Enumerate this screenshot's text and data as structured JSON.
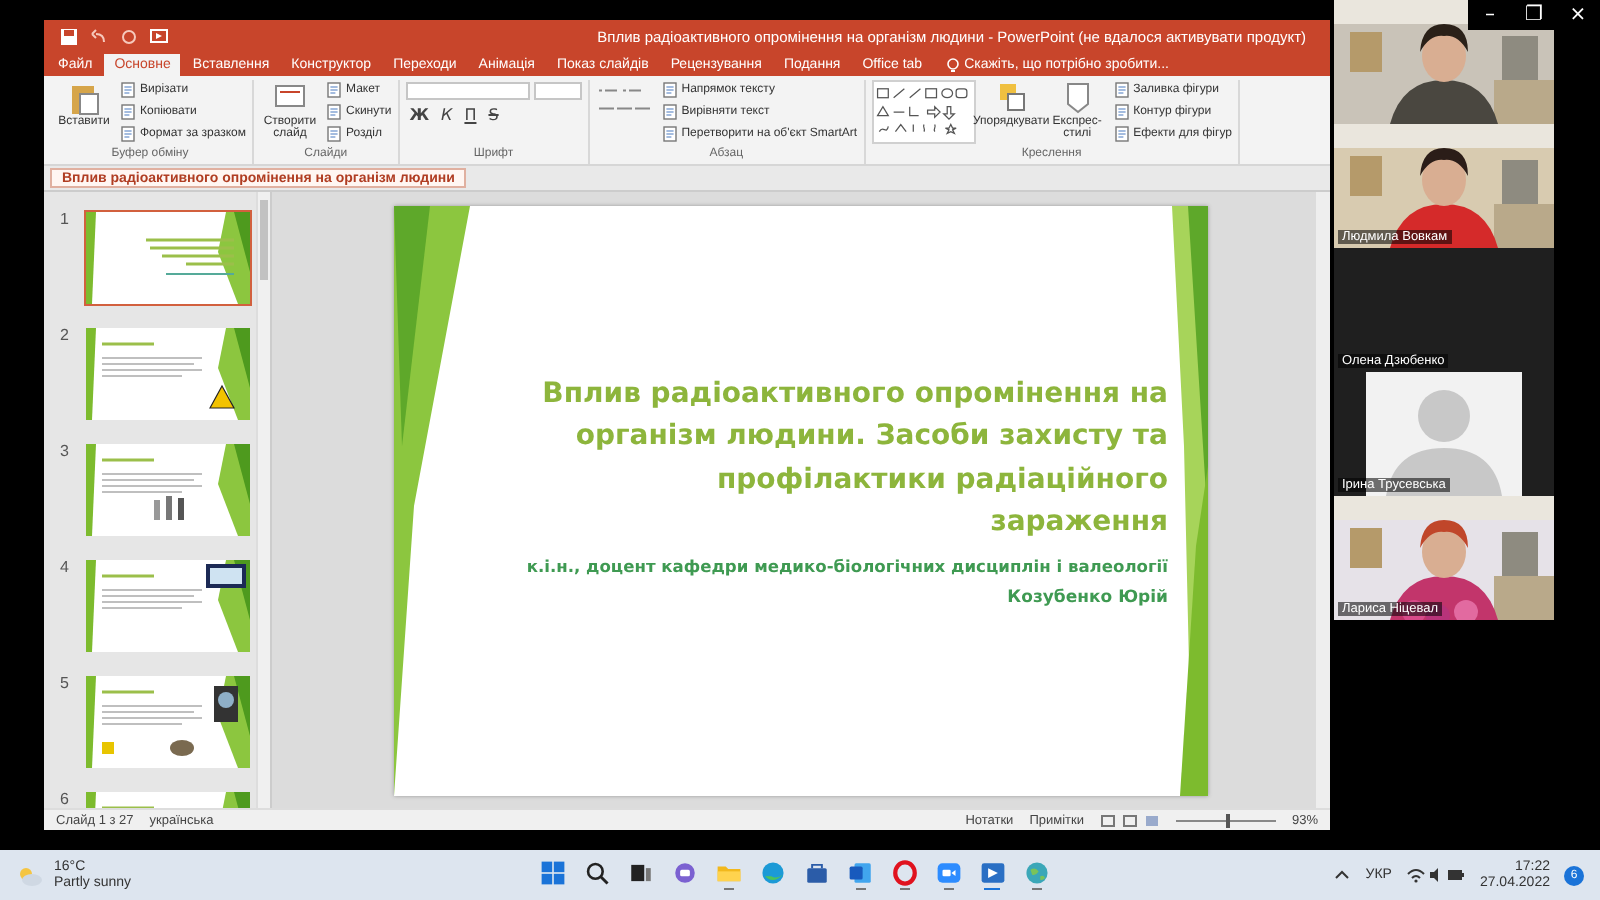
{
  "window": {
    "title": "Вплив радіоактивного опромінення на організм людини - PowerPoint (не вдалося активувати продукт)"
  },
  "ribbon_tabs": [
    {
      "label": "Файл",
      "selected": false
    },
    {
      "label": "Основне",
      "selected": true
    },
    {
      "label": "Вставлення",
      "selected": false
    },
    {
      "label": "Конструктор",
      "selected": false
    },
    {
      "label": "Переходи",
      "selected": false
    },
    {
      "label": "Анімація",
      "selected": false
    },
    {
      "label": "Показ слайдів",
      "selected": false
    },
    {
      "label": "Рецензування",
      "selected": false
    },
    {
      "label": "Подання",
      "selected": false
    },
    {
      "label": "Office tab",
      "selected": false
    }
  ],
  "tell_me": "Скажіть, що потрібно зробити...",
  "ribbon_groups": [
    {
      "kind": "commands",
      "label": "Буфер обміну",
      "big": [
        "Вставити"
      ],
      "small": [
        "Вирізати",
        "Копіювати",
        "Формат за зразком"
      ]
    },
    {
      "kind": "commands",
      "label": "Слайди",
      "big": [
        "Створити слайд"
      ],
      "small": [
        "Макет",
        "Скинути",
        "Розділ"
      ]
    },
    {
      "kind": "font",
      "label": "Шрифт",
      "buttons": [
        "Ж",
        "К",
        "П",
        "S"
      ]
    },
    {
      "kind": "paragraph",
      "label": "Абзац",
      "small": [
        "Напрямок тексту",
        "Вирівняти текст",
        "Перетворити на об'єкт SmartArt"
      ]
    },
    {
      "kind": "drawing",
      "label": "Креслення",
      "big": [
        "Упорядкувати",
        "Експрес-стилі"
      ],
      "small": [
        "Заливка фігури",
        "Контур фігури",
        "Ефекти для фігур"
      ]
    }
  ],
  "document_tab": {
    "title": "Вплив радіоактивного опромінення на організм людини"
  },
  "thumbnails": [
    {
      "number": "1",
      "selected": true
    },
    {
      "number": "2",
      "selected": false
    },
    {
      "number": "3",
      "selected": false
    },
    {
      "number": "4",
      "selected": false
    },
    {
      "number": "5",
      "selected": false
    },
    {
      "number": "6",
      "selected": false
    }
  ],
  "slide": {
    "title": "Вплив радіоактивного опромінення на організм людини. Засоби захисту та профілактики радіаційного зараження",
    "subtitle": "к.і.н., доцент кафедри медико-біологічних дисциплін і валеології",
    "author": "Козубенко Юрій"
  },
  "status_bar": {
    "slide_info": "Слайд 1 з 27",
    "language": "українська",
    "notes": "Нотатки",
    "comments": "Примітки",
    "zoom_slider": {
      "level": 0.5
    },
    "zoom": "93%"
  },
  "zoom_window": {
    "controls": [
      "–",
      "❐",
      "×"
    ]
  },
  "participants": [
    {
      "kind": "video"
    },
    {
      "kind": "video",
      "name": "Людмила Вовкам"
    },
    {
      "kind": "off",
      "name": "Олена Дзюбенко"
    },
    {
      "kind": "avatar",
      "name": "Ірина Трусевська"
    },
    {
      "kind": "video",
      "name": "Лариса Ніцевал"
    }
  ],
  "taskbar": {
    "weather": {
      "temperature": "16°C",
      "condition": "Partly sunny"
    },
    "apps": [
      {
        "kind": "start",
        "running": false
      },
      {
        "kind": "search",
        "running": false
      },
      {
        "kind": "taskview",
        "running": false
      },
      {
        "kind": "chat",
        "running": false
      },
      {
        "kind": "explorer",
        "running": true
      },
      {
        "kind": "edge",
        "running": false
      },
      {
        "kind": "store",
        "running": false
      },
      {
        "kind": "word",
        "running": true
      },
      {
        "kind": "opera",
        "running": true
      },
      {
        "kind": "zoom",
        "running": true
      },
      {
        "kind": "powerpoint",
        "running": true
      },
      {
        "kind": "globe",
        "running": true
      }
    ],
    "language": "УКР",
    "time": "17:22",
    "date": "27.04.2022",
    "badge": "6"
  }
}
